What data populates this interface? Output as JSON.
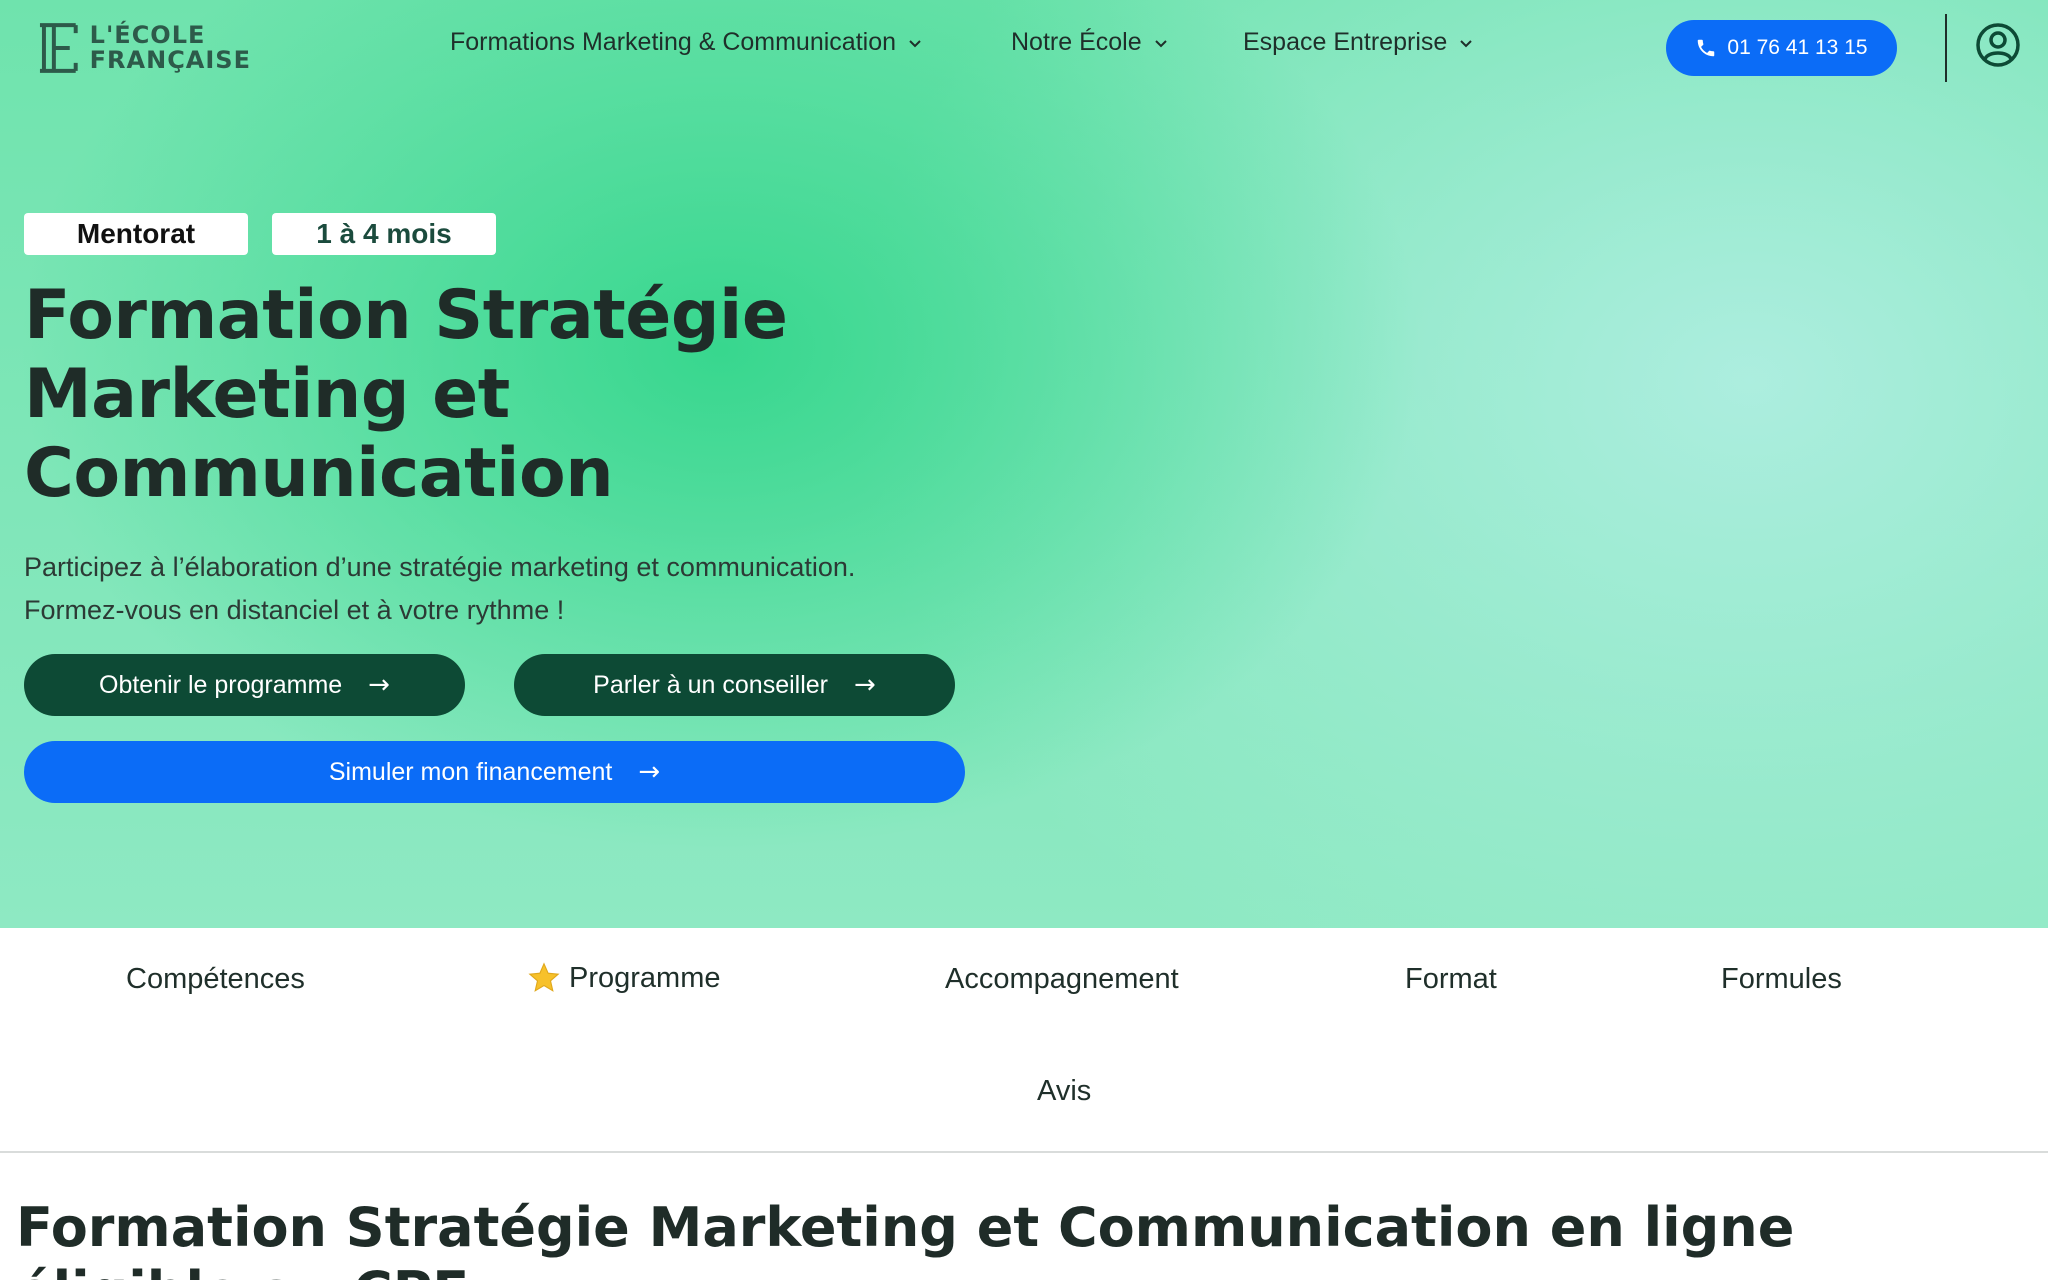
{
  "header": {
    "logo": {
      "line1": "L'ÉCOLE",
      "line2": "FRANÇAISE"
    },
    "nav": [
      {
        "label": "Formations Marketing & Communication"
      },
      {
        "label": "Notre École"
      },
      {
        "label": "Espace Entreprise"
      }
    ],
    "phone": "01 76 41 13 15"
  },
  "hero": {
    "badges": [
      "Mentorat",
      "1 à 4 mois"
    ],
    "title_lines": [
      "Formation Stratégie",
      "Marketing et",
      "Communication"
    ],
    "subtitle_lines": [
      "Participez à l’élaboration d’une stratégie marketing et communication.",
      "Formez-vous en distanciel et à votre rythme !"
    ],
    "buttons": {
      "programme": "Obtenir le programme",
      "conseiller": "Parler à un conseiller",
      "financement": "Simuler mon financement"
    },
    "arrow": "→"
  },
  "tabs": [
    "Compétences",
    "Programme",
    "Accompagnement",
    "Format",
    "Formules",
    "Avis"
  ],
  "section": {
    "title": "Formation Stratégie Marketing et Communication en ligne éligible au CPF"
  },
  "colors": {
    "accent_blue": "#0b6cf7",
    "dark_green": "#0d4a35",
    "brand_green": "#2d5a4a"
  }
}
